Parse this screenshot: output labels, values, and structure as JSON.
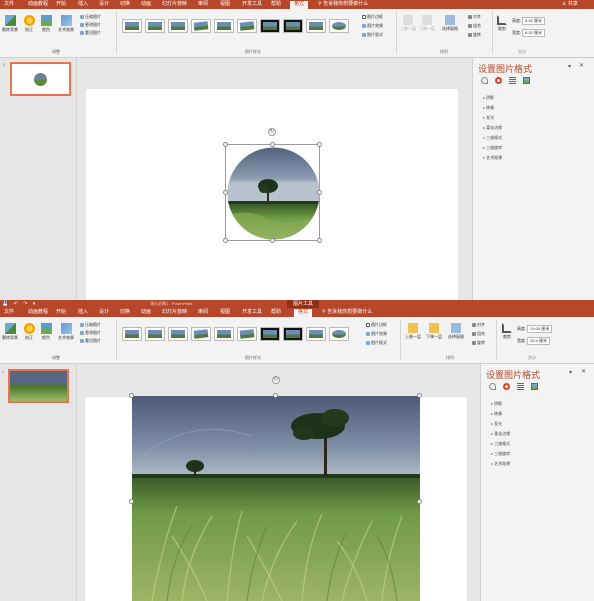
{
  "shotA": {
    "menu": [
      "文件",
      "动画教程",
      "开始",
      "插入",
      "设计",
      "切换",
      "动画",
      "幻灯片放映",
      "审阅",
      "视图",
      "开发工具",
      "帮助",
      "格式"
    ],
    "tell_me": "告诉我你想要做什么",
    "share": "共享",
    "ribbon": {
      "adjust": {
        "remove_bg": "删除背景",
        "corrections": "校正",
        "color": "颜色",
        "artistic": "艺术效果",
        "compress": "压缩图片",
        "change": "更改图片",
        "reset": "重设图片",
        "label": "调整"
      },
      "styles": {
        "border": "图片边框",
        "effects": "图片效果",
        "layout": "图片版式",
        "label": "图片样式"
      },
      "arrange": {
        "forward": "上移一层",
        "backward": "下移一层",
        "selection": "选择窗格",
        "align": "对齐",
        "group": "组合",
        "rotate": "旋转",
        "label": "排列"
      },
      "size": {
        "crop": "裁剪",
        "height_label": "高度:",
        "height_value": "8.52 厘米",
        "width_label": "宽度:",
        "width_value": "8.52 厘米",
        "label": "大小"
      }
    },
    "slide_num": "1",
    "format_pane": {
      "title": "设置图片格式",
      "items": [
        "阴影",
        "映像",
        "发光",
        "柔化边缘",
        "三维格式",
        "三维旋转",
        "艺术效果"
      ]
    }
  },
  "shotB": {
    "title_bar": {
      "document": "演示文稿1 - PowerPoint",
      "tools": "图片工具"
    },
    "menu": [
      "文件",
      "动画教程",
      "开始",
      "插入",
      "设计",
      "切换",
      "动画",
      "幻灯片放映",
      "审阅",
      "视图",
      "开发工具",
      "帮助",
      "格式"
    ],
    "tell_me": "告诉我你想要做什么",
    "ribbon": {
      "adjust": {
        "remove_bg": "删除背景",
        "corrections": "校正",
        "color": "颜色",
        "artistic": "艺术效果",
        "compress": "压缩图片",
        "change": "更改图片",
        "reset": "重设图片",
        "label": "调整"
      },
      "styles": {
        "border": "图片边框",
        "effects": "图片效果",
        "layout": "图片版式",
        "label": "图片样式"
      },
      "arrange": {
        "forward": "上移一层",
        "backward": "下移一层",
        "selection": "选择窗格",
        "align": "对齐",
        "group": "组合",
        "rotate": "旋转",
        "label": "排列"
      },
      "size": {
        "crop": "裁剪",
        "height_label": "高度:",
        "height_value": "19.05 厘米",
        "width_label": "宽度:",
        "width_value": "25.4 厘米",
        "label": "大小"
      }
    },
    "slide_num": "1",
    "format_pane": {
      "title": "设置图片格式",
      "items": [
        "阴影",
        "映像",
        "发光",
        "柔化边缘",
        "三维格式",
        "三维旋转",
        "艺术效果"
      ]
    }
  },
  "colors": {
    "accent": "#b7472a",
    "ribbon": "#f3f3f3",
    "workspace": "#e6e6e6",
    "thumb_selected": "#e8734d"
  }
}
